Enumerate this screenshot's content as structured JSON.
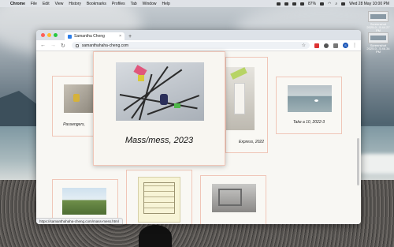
{
  "menubar": {
    "app": "Chrome",
    "items": [
      "File",
      "Edit",
      "View",
      "History",
      "Bookmarks",
      "Profiles",
      "Tab",
      "Window",
      "Help"
    ],
    "battery": "87%",
    "datetime": "Wed 28 May 10:00 PM"
  },
  "desktop_icons": [
    {
      "label_1": "Screenshot",
      "label_2": "2025-0...5.44.27 PM"
    },
    {
      "label_1": "Screenshot",
      "label_2": "2025-0...5.46.34 PM"
    }
  ],
  "browser": {
    "tab_title": "Samantha Cheng",
    "address": "samanthahaha-cheng.com",
    "profile_initial": "S",
    "status_url": "https://samanthahaha-cheng.com/mass-mess.html",
    "colors": {
      "accent_border": "#f0c6b8",
      "profile": "#1a56b8"
    }
  },
  "gallery": {
    "card_left": "Passengers,",
    "card_mid_right": "Express, 2022",
    "card_right": "Take a 10, 2022-3"
  },
  "modal": {
    "title": "Mass/mess, 2023"
  }
}
